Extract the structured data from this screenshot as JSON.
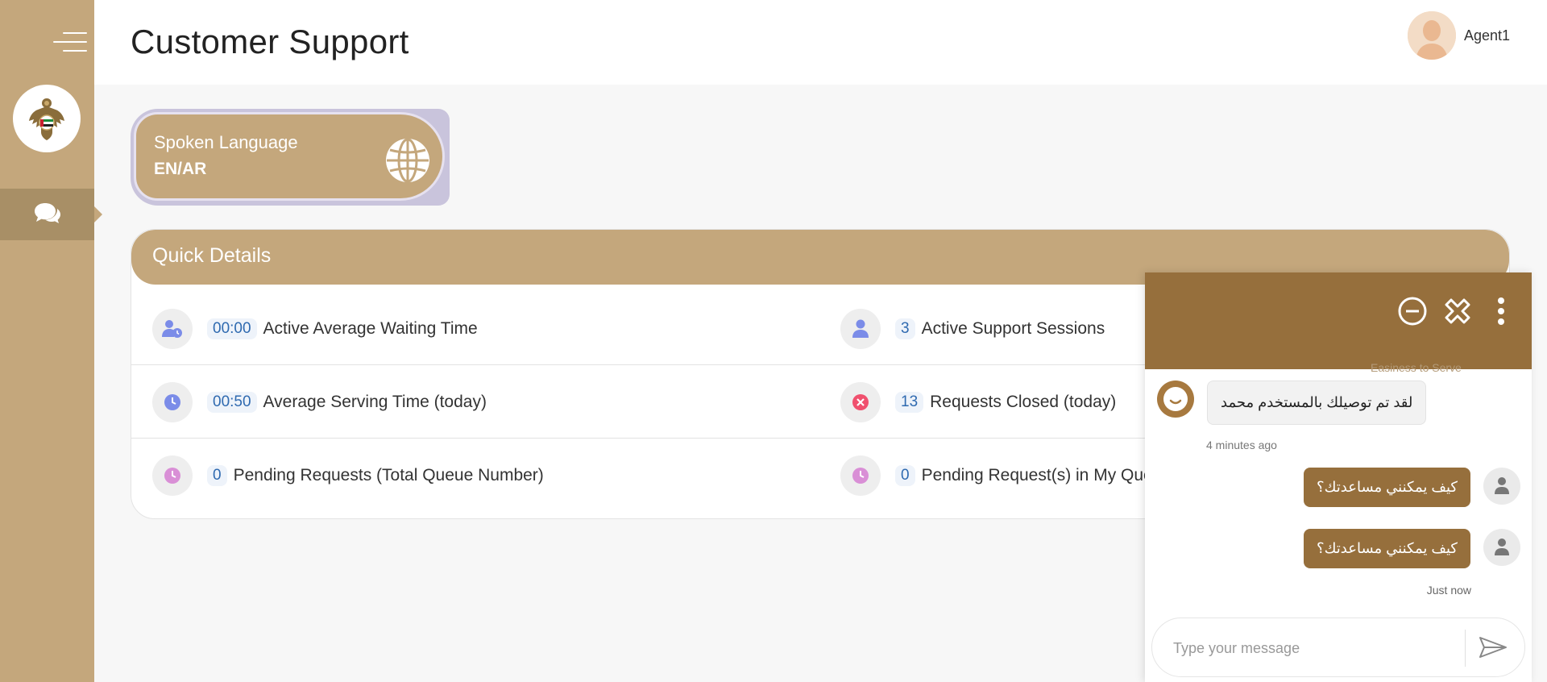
{
  "header": {
    "title": "Customer Support",
    "agent_name": "Agent1"
  },
  "sidebar": {
    "items": [
      {
        "name": "chat",
        "icon": "chat-bubbles-icon",
        "active": true
      }
    ]
  },
  "language_card": {
    "label": "Spoken Language",
    "value": "EN/AR"
  },
  "quick_details": {
    "title": "Quick Details",
    "items": [
      {
        "value": "00:00",
        "label": "Active Average Waiting Time",
        "icon": "user-clock-icon"
      },
      {
        "value": "3",
        "label": "Active Support Sessions",
        "icon": "user-icon"
      },
      {
        "value": "00:50",
        "label": "Average Serving Time (today)",
        "icon": "clock-icon"
      },
      {
        "value": "13",
        "label": "Requests Closed (today)",
        "icon": "close-circle-icon"
      },
      {
        "value": "0",
        "label": "Pending Requests (Total Queue Number)",
        "icon": "clock-icon"
      },
      {
        "value": "0",
        "label": "Pending Request(s) in My Queue",
        "icon": "clock-icon"
      }
    ]
  },
  "chat": {
    "header_subtext": "Easiness to Serve",
    "messages": [
      {
        "direction": "in",
        "text": "لقد تم توصيلك بالمستخدم محمد",
        "time": "4 minutes ago"
      },
      {
        "direction": "out",
        "text": "كيف يمكنني مساعدتك؟"
      },
      {
        "direction": "out",
        "text": "كيف يمكنني مساعدتك؟",
        "time": "Just now"
      }
    ],
    "input_placeholder": "Type your message"
  },
  "colors": {
    "sidebar": "#c4a77c",
    "sidebar_active": "#a88f66",
    "chat_header": "#966f3c",
    "accent_blue": "#2f6ab0"
  }
}
